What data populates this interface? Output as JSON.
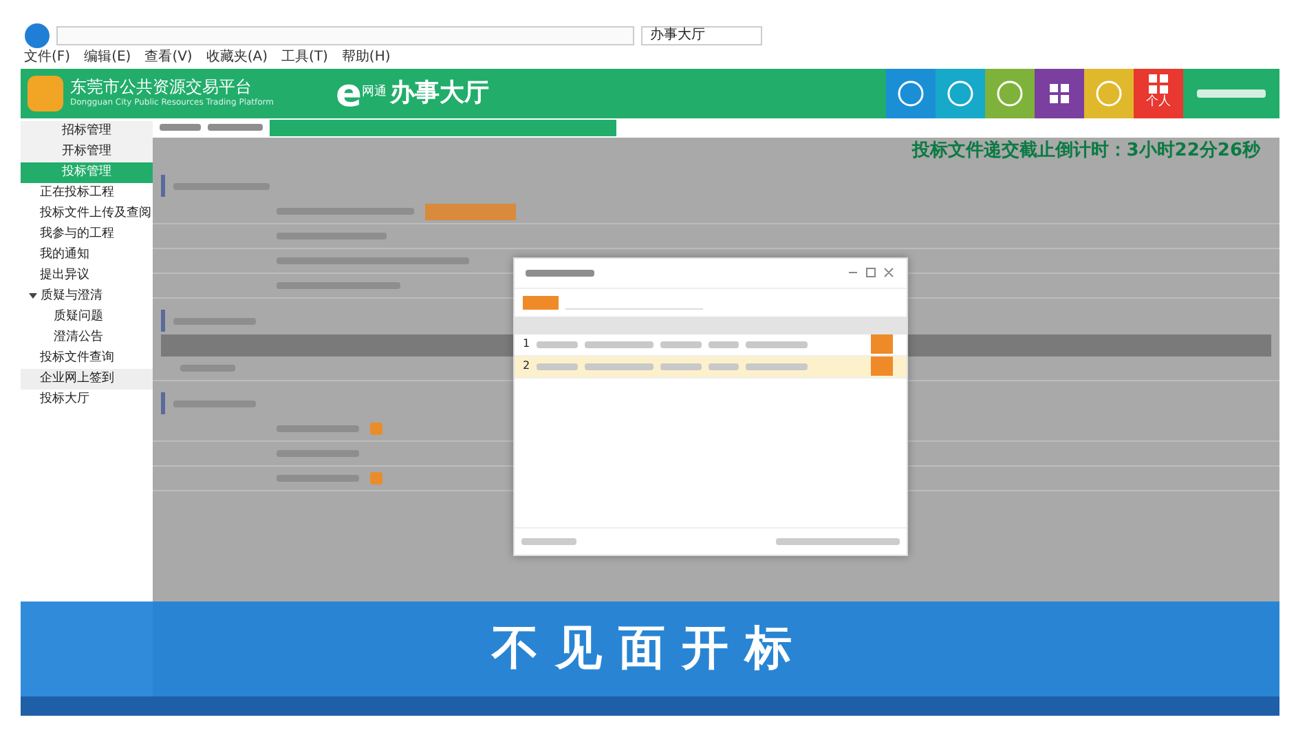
{
  "browser": {
    "tab_title": "办事大厅",
    "menu": [
      "文件(F)",
      "编辑(E)",
      "查看(V)",
      "收藏夹(A)",
      "工具(T)",
      "帮助(H)"
    ]
  },
  "header": {
    "logo_title": "东莞市公共资源交易平台",
    "logo_subtitle": "Dongguan City Public Resources Trading Platform",
    "brand_mark": "e",
    "brand_small": "网通",
    "brand_title": "办事大厅",
    "tiles": [
      {
        "color": "#1a8fd6",
        "kind": "circle"
      },
      {
        "color": "#17a9c9",
        "kind": "circle"
      },
      {
        "color": "#7fb23a",
        "kind": "circle"
      },
      {
        "color": "#7b3fa0",
        "kind": "grid"
      },
      {
        "color": "#e0b82c",
        "kind": "circle"
      },
      {
        "color": "#e8382f",
        "kind": "grid",
        "label": "个人"
      }
    ]
  },
  "sidebar": {
    "items": [
      {
        "label": "招标管理",
        "kind": "group",
        "selected": false
      },
      {
        "label": "开标管理",
        "kind": "group",
        "selected": false
      },
      {
        "label": "投标管理",
        "kind": "group",
        "selected": true
      },
      {
        "label": "正在投标工程",
        "kind": "link",
        "selected": false
      },
      {
        "label": "投标文件上传及查阅",
        "kind": "link",
        "selected": false
      },
      {
        "label": "我参与的工程",
        "kind": "link",
        "selected": false
      },
      {
        "label": "我的通知",
        "kind": "link",
        "selected": false
      },
      {
        "label": "提出异议",
        "kind": "link",
        "selected": false
      },
      {
        "label": "质疑与澄清",
        "kind": "folder",
        "selected": false,
        "expanded": true,
        "children": [
          {
            "label": "质疑问题",
            "selected": false
          },
          {
            "label": "澄清公告",
            "selected": false
          }
        ]
      },
      {
        "label": "投标文件查询",
        "kind": "link",
        "selected": false
      },
      {
        "label": "企业网上签到",
        "kind": "link",
        "selected": false,
        "hover": true
      },
      {
        "label": "投标大厅",
        "kind": "link",
        "selected": false
      }
    ]
  },
  "countdown": "投标文件递交截止倒计时：3小时22分26秒",
  "modal": {
    "rows": [
      {
        "index": "1",
        "selected": false
      },
      {
        "index": "2",
        "selected": true
      }
    ]
  },
  "caption": "不见面开标"
}
